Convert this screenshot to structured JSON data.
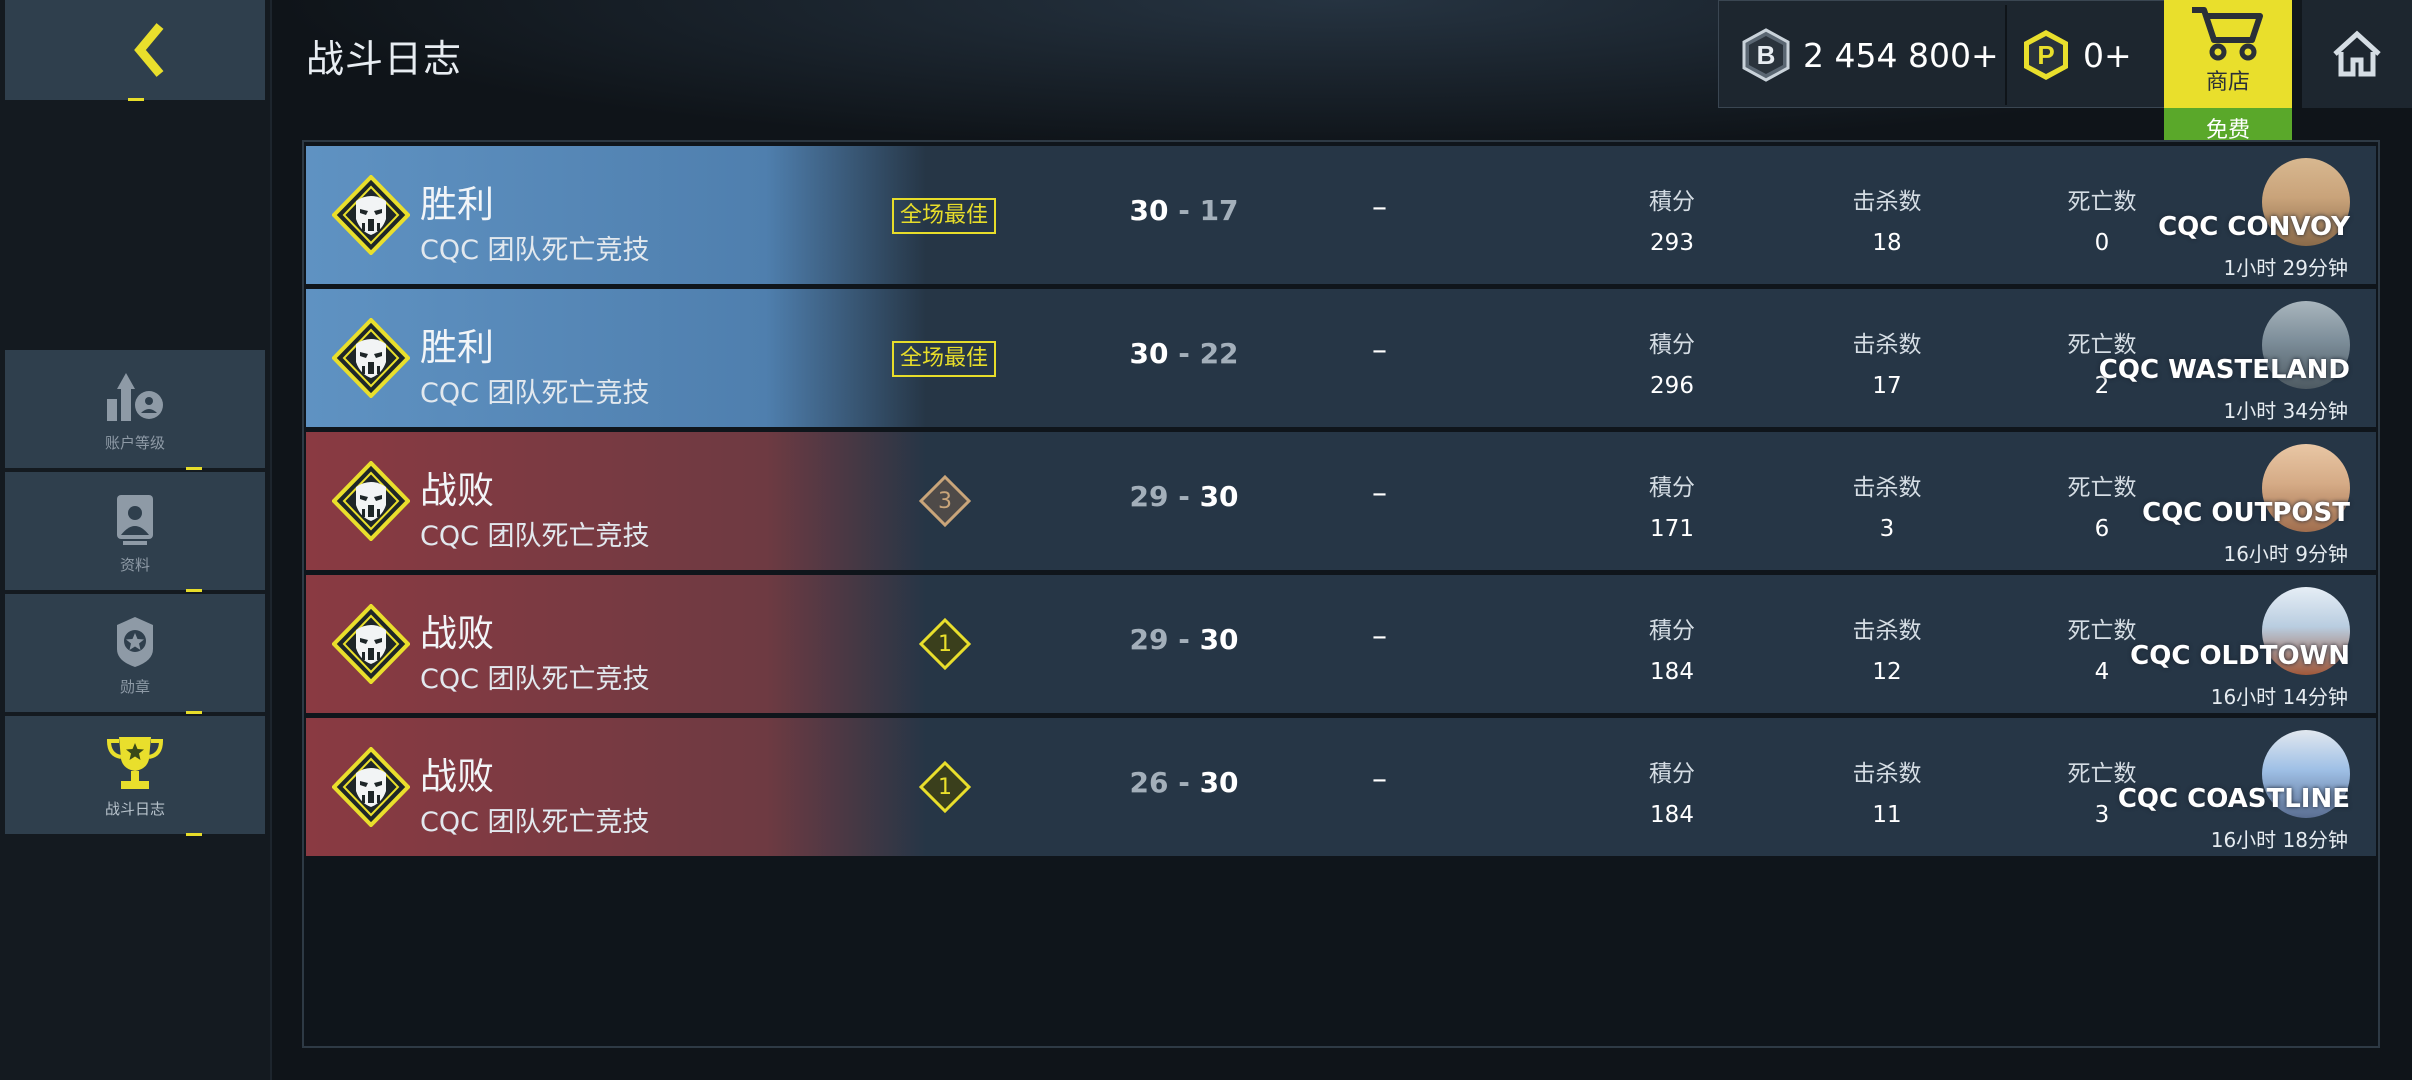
{
  "header": {
    "title": "战斗日志"
  },
  "currency": {
    "credits": {
      "icon": "b-coin-icon",
      "value": "2 454 800+"
    },
    "cod_points": {
      "icon": "p-coin-icon",
      "value": "0+"
    }
  },
  "shop": {
    "label": "商店",
    "badge": "免费"
  },
  "sidebar": {
    "items": [
      {
        "label": "账户等级",
        "icon": "account-level-icon"
      },
      {
        "label": "资料",
        "icon": "profile-icon"
      },
      {
        "label": "勋章",
        "icon": "medal-icon"
      },
      {
        "label": "战斗日志",
        "icon": "trophy-icon",
        "active": true
      }
    ]
  },
  "stat_labels": {
    "points": "積分",
    "kills": "击杀数",
    "deaths": "死亡数"
  },
  "matches": [
    {
      "result": "胜利",
      "mode": "CQC 团队死亡竞技",
      "outcome": "win",
      "badge": "全场最佳",
      "rank": "",
      "score_a": "30",
      "score_sep": "-",
      "score_b": "17",
      "dash": "–",
      "points": "293",
      "kills": "18",
      "deaths": "0",
      "map": "CQC CONVOY",
      "time": "1小时 29分钟"
    },
    {
      "result": "胜利",
      "mode": "CQC 团队死亡竞技",
      "outcome": "win",
      "badge": "全场最佳",
      "rank": "",
      "score_a": "30",
      "score_sep": "-",
      "score_b": "22",
      "dash": "–",
      "points": "296",
      "kills": "17",
      "deaths": "2",
      "map": "CQC WASTELAND",
      "time": "1小时 34分钟"
    },
    {
      "result": "战败",
      "mode": "CQC 团队死亡竞技",
      "outcome": "loss",
      "badge": "",
      "rank": "3",
      "score_a": "29",
      "score_sep": "-",
      "score_b": "30",
      "dash": "–",
      "points": "171",
      "kills": "3",
      "deaths": "6",
      "map": "CQC OUTPOST",
      "time": "16小时 9分钟"
    },
    {
      "result": "战败",
      "mode": "CQC 团队死亡竞技",
      "outcome": "loss",
      "badge": "",
      "rank": "1",
      "score_a": "29",
      "score_sep": "-",
      "score_b": "30",
      "dash": "–",
      "points": "184",
      "kills": "12",
      "deaths": "4",
      "map": "CQC OLDTOWN",
      "time": "16小时 14分钟"
    },
    {
      "result": "战败",
      "mode": "CQC 团队死亡竞技",
      "outcome": "loss",
      "badge": "",
      "rank": "1",
      "score_a": "26",
      "score_sep": "-",
      "score_b": "30",
      "dash": "–",
      "points": "184",
      "kills": "11",
      "deaths": "3",
      "map": "CQC COASTLINE",
      "time": "16小时 18分钟"
    }
  ],
  "colors": {
    "accent_yellow": "#e9df2c",
    "win": "#5f92c2",
    "loss": "#8a3a42",
    "free_green": "#5aa82a",
    "rank_bronze": "#c9a57a"
  }
}
